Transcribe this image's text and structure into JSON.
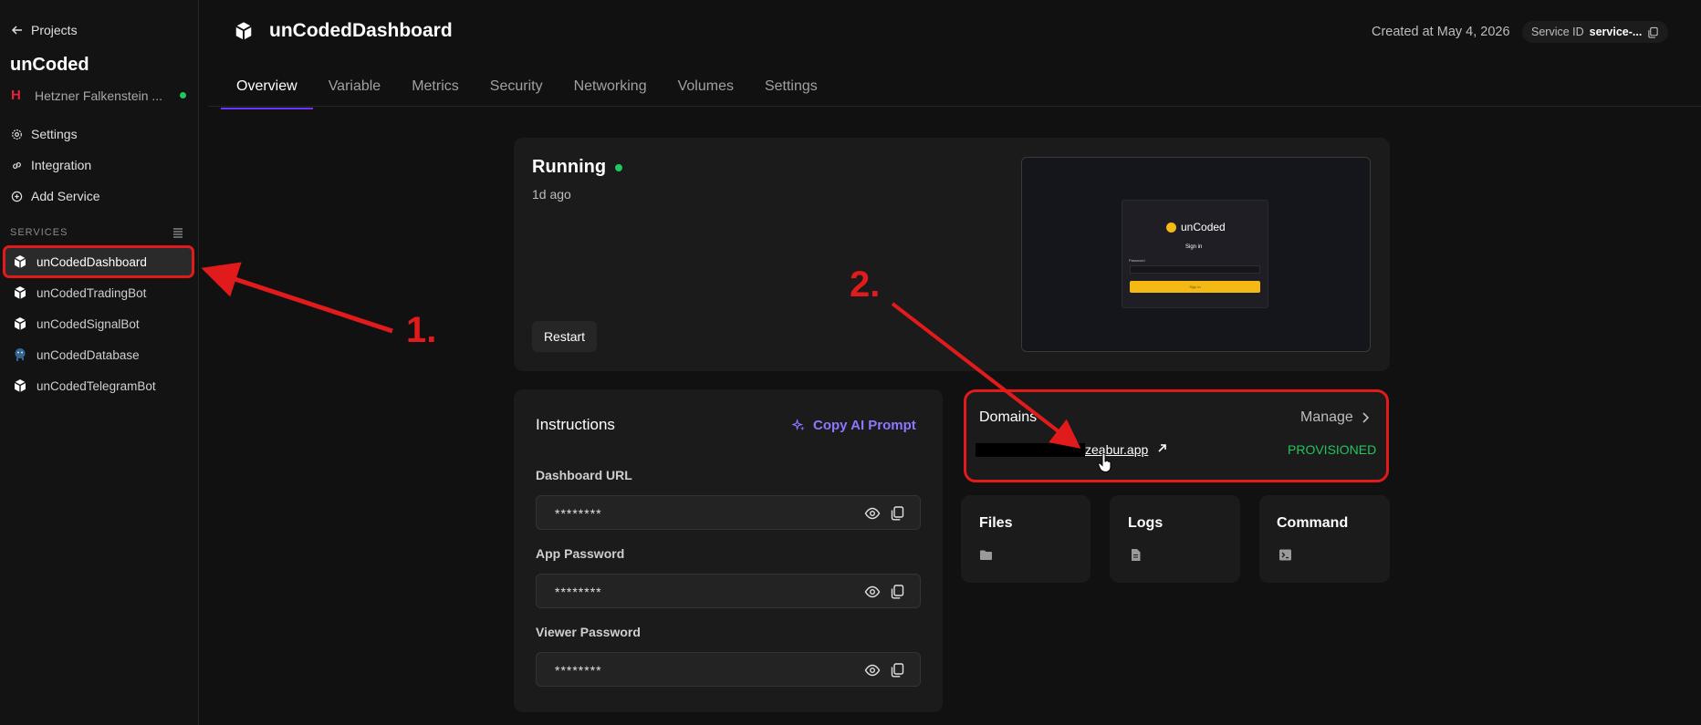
{
  "sidebar": {
    "back_label": "Projects",
    "project_name": "unCoded",
    "region": "Hetzner Falkenstein ...",
    "nav": [
      "Settings",
      "Integration",
      "Add Service"
    ],
    "services_label": "SERVICES",
    "services": [
      {
        "name": "unCodedDashboard",
        "icon": "cube-icon",
        "active": true
      },
      {
        "name": "unCodedTradingBot",
        "icon": "cube-icon"
      },
      {
        "name": "unCodedSignalBot",
        "icon": "cube-icon"
      },
      {
        "name": "unCodedDatabase",
        "icon": "postgres-icon"
      },
      {
        "name": "unCodedTelegramBot",
        "icon": "cube-icon"
      }
    ]
  },
  "header": {
    "title": "unCodedDashboard",
    "created": "Created at May 4, 2026",
    "service_id_label": "Service ID",
    "service_id_value": "service-..."
  },
  "tabs": [
    "Overview",
    "Variable",
    "Metrics",
    "Security",
    "Networking",
    "Volumes",
    "Settings"
  ],
  "status": {
    "state": "Running",
    "time": "1d ago",
    "restart_label": "Restart",
    "preview": {
      "brand": "unCoded",
      "sign_in": "Sign in",
      "password_label": "Password",
      "button": "Sign in"
    }
  },
  "instructions": {
    "title": "Instructions",
    "copy_prompt": "Copy AI Prompt",
    "fields": [
      {
        "label": "Dashboard URL",
        "value": "********"
      },
      {
        "label": "App Password",
        "value": "********"
      },
      {
        "label": "Viewer Password",
        "value": "********"
      }
    ]
  },
  "domains": {
    "title": "Domains",
    "manage": "Manage",
    "domain": "zeabur.app",
    "status": "PROVISIONED"
  },
  "tiles": [
    {
      "title": "Files",
      "icon": "folder-icon"
    },
    {
      "title": "Logs",
      "icon": "file-icon"
    },
    {
      "title": "Command",
      "icon": "terminal-icon"
    }
  ],
  "annotations": [
    "1.",
    "2."
  ],
  "colors": {
    "accent": "#6d33ff",
    "success": "#22c55e",
    "annotation": "#e11b1b",
    "brand": "#f5b915"
  }
}
